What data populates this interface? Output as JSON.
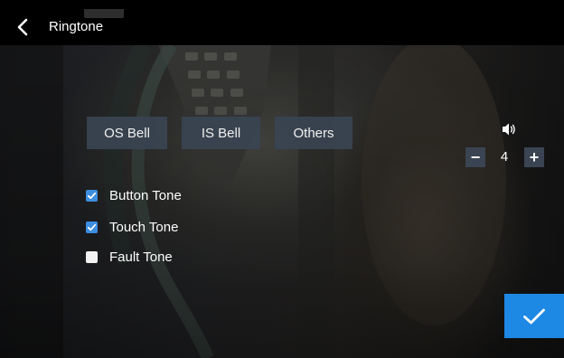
{
  "header": {
    "title": "Ringtone",
    "back_icon": "chevron-left-icon"
  },
  "tabs": [
    {
      "label": "OS Bell"
    },
    {
      "label": "IS Bell"
    },
    {
      "label": "Others"
    }
  ],
  "volume": {
    "icon": "speaker-icon",
    "value": "4",
    "minus_label": "−",
    "plus_label": "+"
  },
  "options": [
    {
      "label": "Button Tone",
      "checked": true
    },
    {
      "label": "Touch Tone",
      "checked": true
    },
    {
      "label": "Fault Tone",
      "checked": false
    }
  ],
  "confirm": {
    "icon": "checkmark-icon"
  },
  "colors": {
    "header_bg": "#000000",
    "tab_bg": "#3a4452",
    "checkbox_checked": "#3d8ee0",
    "confirm_bg": "#1e88e5",
    "text": "#ffffff"
  }
}
